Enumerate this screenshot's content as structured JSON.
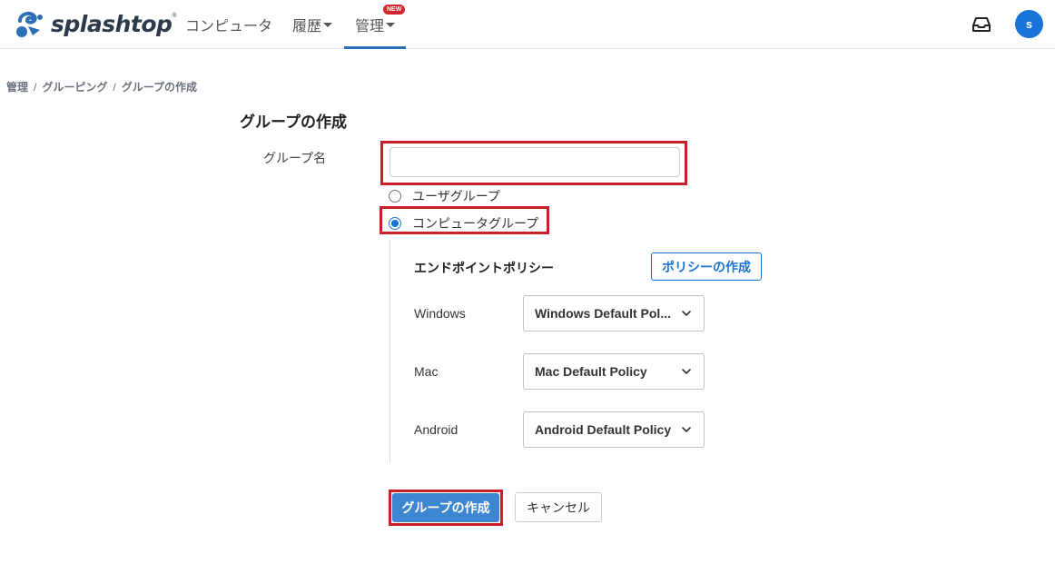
{
  "header": {
    "brand": "splashtop",
    "brand_mark": "®",
    "nav": [
      {
        "label": "コンピュータ"
      },
      {
        "label": "履歴"
      },
      {
        "label": "管理",
        "badge": "NEW"
      }
    ],
    "avatar_initial": "s",
    "icons": {
      "logo": "splashtop-logo-icon",
      "inbox": "inbox-icon"
    }
  },
  "breadcrumb": [
    "管理",
    "グルーピング",
    "グループの作成"
  ],
  "breadcrumb_separator": "/",
  "form": {
    "title": "グループの作成",
    "name_label": "グループ名",
    "name_value": "",
    "group_types": [
      {
        "label": "ユーザグループ",
        "selected": false
      },
      {
        "label": "コンピュータグループ",
        "selected": true
      }
    ],
    "policy_section_title": "エンドポイントポリシー",
    "create_policy_label": "ポリシーの作成",
    "policies": [
      {
        "os": "Windows",
        "value": "Windows Default Pol..."
      },
      {
        "os": "Mac",
        "value": "Mac Default Policy"
      },
      {
        "os": "Android",
        "value": "Android Default Policy"
      }
    ],
    "submit_label": "グループの作成",
    "cancel_label": "キャンセル"
  },
  "colors": {
    "accent": "#1a73d9",
    "primary_button": "#3d86d1",
    "highlight_border": "#c8202a",
    "badge": "#d0262d"
  }
}
